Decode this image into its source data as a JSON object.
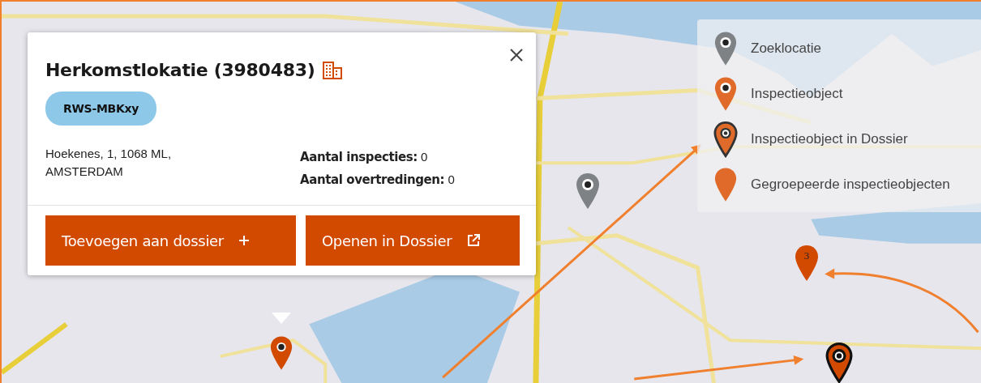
{
  "popup": {
    "title": "Herkomstlokatie (3980483)",
    "tag": "RWS-MBKxy",
    "address_lines": [
      "Hoekenes, 1, 1068 ML,",
      "AMSTERDAM"
    ],
    "stats": [
      {
        "label": "Aantal inspecties:",
        "value": "0"
      },
      {
        "label": "Aantal overtredingen:",
        "value": "0"
      }
    ],
    "buttons": [
      {
        "label": "Toevoegen aan dossier",
        "kind": "add"
      },
      {
        "label": "Openen in Dossier",
        "kind": "external"
      }
    ]
  },
  "legend": [
    {
      "label": "Zoeklocatie",
      "kind": "search"
    },
    {
      "label": "Inspectieobject",
      "kind": "object"
    },
    {
      "label": "Inspectieobject in Dossier",
      "kind": "dossier"
    },
    {
      "label": "Gegroepeerde inspectieobjecten",
      "kind": "group"
    }
  ],
  "map_markers": [
    {
      "kind": "search"
    },
    {
      "kind": "object"
    },
    {
      "kind": "group",
      "count": "3"
    },
    {
      "kind": "dossier"
    }
  ]
}
